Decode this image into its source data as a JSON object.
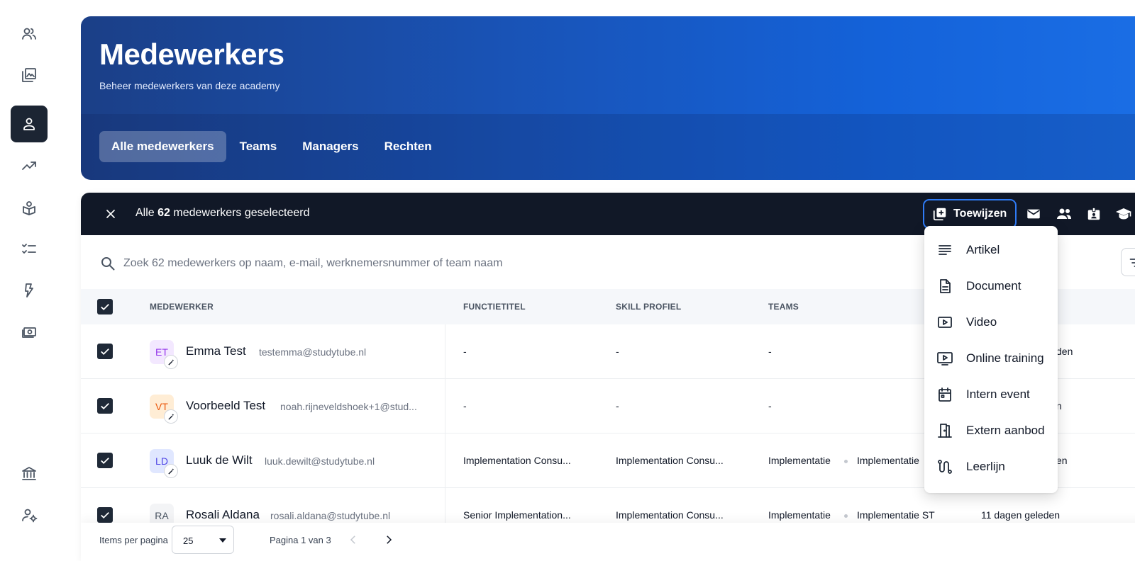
{
  "sidebar": {
    "items": [
      {
        "icon": "users-icon"
      },
      {
        "icon": "library-icon"
      },
      {
        "icon": "employee-icon",
        "active": true
      },
      {
        "icon": "trending-icon"
      },
      {
        "icon": "learning-icon"
      },
      {
        "icon": "checklist-icon"
      },
      {
        "icon": "bolt-icon"
      },
      {
        "icon": "payment-icon"
      },
      {
        "icon": "academy-icon"
      },
      {
        "icon": "user-settings-icon"
      }
    ]
  },
  "header": {
    "title": "Medewerkers",
    "subtitle": "Beheer medewerkers van deze academy",
    "tabs": [
      {
        "label": "Alle medewerkers",
        "active": true
      },
      {
        "label": "Teams"
      },
      {
        "label": "Managers"
      },
      {
        "label": "Rechten"
      }
    ]
  },
  "selection": {
    "prefix": "Alle",
    "count": "62",
    "suffix": "medewerkers geselecteerd",
    "assign_label": "Toewijzen"
  },
  "search": {
    "placeholder": "Zoek 62 medewerkers op naam, e-mail, werknemersnummer of team naam"
  },
  "table": {
    "headers": {
      "employee": "MEDEWERKER",
      "job_title": "FUNCTIETITEL",
      "skill_profile": "SKILL PROFIEL",
      "teams": "TEAMS"
    },
    "rows": [
      {
        "initials": "ET",
        "name": "Emma Test",
        "email": "testemma@studytube.nl",
        "job_title": "-",
        "skill_profile": "-",
        "team1": "-",
        "team2": "",
        "last": "den"
      },
      {
        "initials": "VT",
        "name": "Voorbeeld Test",
        "email": "noah.rijneveldshoek+1@stud...",
        "job_title": "-",
        "skill_profile": "-",
        "team1": "-",
        "team2": "",
        "last": "n"
      },
      {
        "initials": "LD",
        "name": "Luuk de Wilt",
        "email": "luuk.dewilt@studytube.nl",
        "job_title": "Implementation Consu...",
        "skill_profile": "Implementation Consu...",
        "team1": "Implementatie",
        "team2": "Implementatie",
        "last": "en"
      },
      {
        "initials": "RA",
        "name": "Rosali Aldana",
        "email": "rosali.aldana@studytube.nl",
        "job_title": "Senior Implementation...",
        "skill_profile": "Implementation Consu...",
        "team1": "Implementatie",
        "team2": "Implementatie ST",
        "last": "11 dagen geleden"
      }
    ]
  },
  "footer": {
    "items_per_page_label": "Items per pagina",
    "items_per_page_value": "25",
    "page_info": "Pagina 1 van 3"
  },
  "assign_menu": {
    "items": [
      {
        "label": "Artikel",
        "icon": "article-icon"
      },
      {
        "label": "Document",
        "icon": "document-icon"
      },
      {
        "label": "Video",
        "icon": "video-icon"
      },
      {
        "label": "Online training",
        "icon": "online-training-icon"
      },
      {
        "label": "Intern event",
        "icon": "calendar-icon"
      },
      {
        "label": "Extern aanbod",
        "icon": "door-icon"
      },
      {
        "label": "Leerlijn",
        "icon": "learning-path-icon"
      }
    ]
  },
  "colors": {
    "accent": "#2f7bf6",
    "dark": "#111827",
    "hero_start": "#1b3f87",
    "hero_end": "#1a6ee5"
  }
}
